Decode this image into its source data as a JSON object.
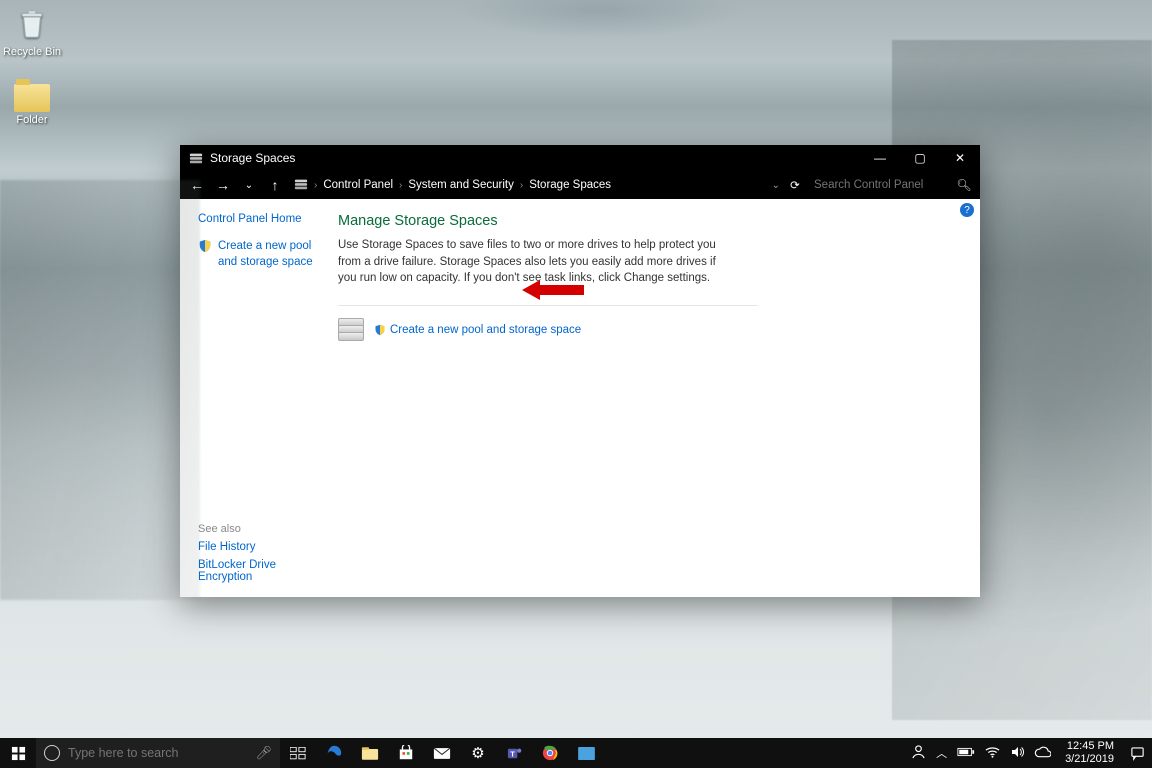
{
  "desktop": {
    "recycle_bin_label": "Recycle Bin",
    "folder_label": "Folder"
  },
  "window": {
    "title": "Storage Spaces",
    "controls": {
      "min": "—",
      "max": "▢",
      "close": "✕"
    },
    "breadcrumb": {
      "items": [
        "Control Panel",
        "System and Security",
        "Storage Spaces"
      ]
    },
    "search_placeholder": "Search Control Panel",
    "help_tooltip": "?"
  },
  "leftnav": {
    "home": "Control Panel Home",
    "task_create": "Create a new pool and storage space",
    "see_also_heading": "See also",
    "see_also": [
      "File History",
      "BitLocker Drive Encryption"
    ]
  },
  "main": {
    "heading": "Manage Storage Spaces",
    "description": "Use Storage Spaces to save files to two or more drives to help protect you from a drive failure. Storage Spaces also lets you easily add more drives if you run low on capacity. If you don't see task links, click Change settings.",
    "action_link": "Create a new pool and storage space"
  },
  "taskbar": {
    "search_placeholder": "Type here to search",
    "clock_time": "12:45 PM",
    "clock_date": "3/21/2019"
  }
}
